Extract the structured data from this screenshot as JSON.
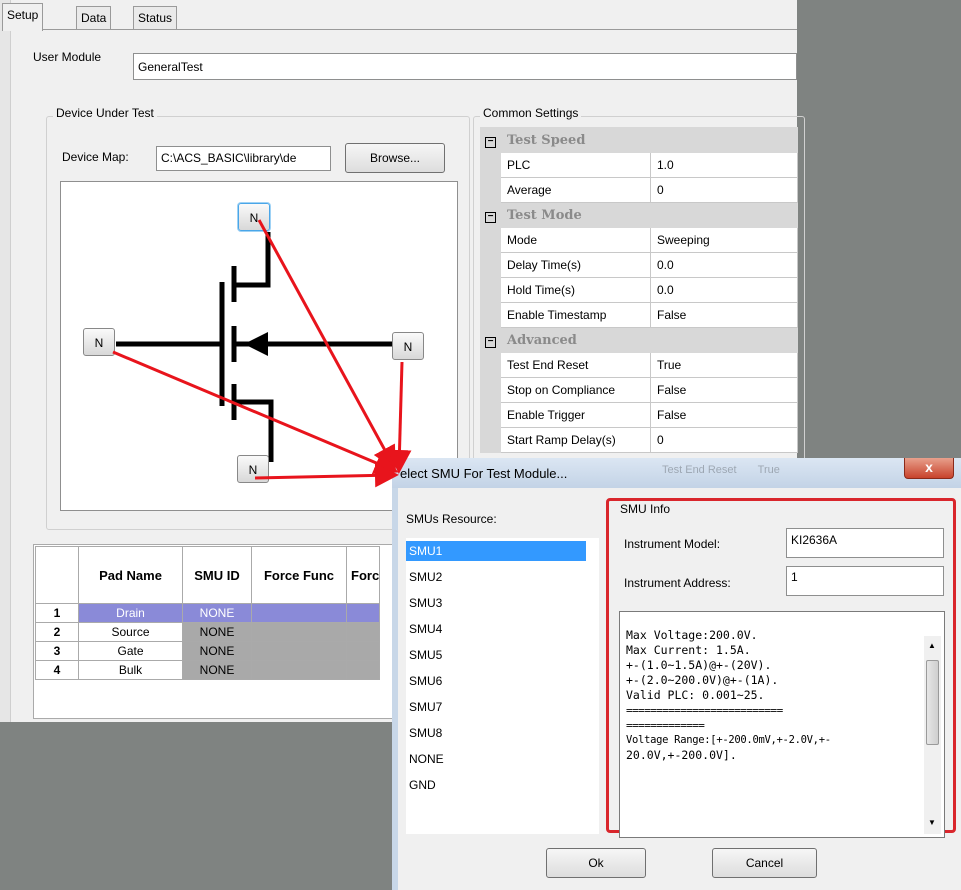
{
  "tabs": [
    {
      "label": "Setup"
    },
    {
      "label": "Data"
    },
    {
      "label": "Status"
    }
  ],
  "user_module": {
    "label": "User Module",
    "value": "GeneralTest"
  },
  "dut": {
    "legend": "Device Under Test",
    "device_map_label": "Device Map:",
    "device_map_value": "C:\\ACS_BASIC\\library\\de",
    "browse_label": "Browse...",
    "nodes": {
      "top": "N",
      "left": "N",
      "right": "N",
      "bottom": "N"
    }
  },
  "common_settings": {
    "legend": "Common Settings",
    "categories": [
      {
        "name": "Test Speed",
        "expander": "⊟",
        "rows": [
          {
            "name": "PLC",
            "value": "1.0"
          },
          {
            "name": "Average",
            "value": "0"
          }
        ]
      },
      {
        "name": "Test Mode",
        "expander": "⊟",
        "rows": [
          {
            "name": "Mode",
            "value": "Sweeping"
          },
          {
            "name": "Delay Time(s)",
            "value": "0.0"
          },
          {
            "name": "Hold Time(s)",
            "value": "0.0"
          },
          {
            "name": "Enable Timestamp",
            "value": "False"
          }
        ]
      },
      {
        "name": "Advanced",
        "expander": "⊟",
        "rows": [
          {
            "name": "Test End Reset",
            "value": "True"
          },
          {
            "name": "Stop on Compliance",
            "value": "False"
          },
          {
            "name": "Enable Trigger",
            "value": "False"
          },
          {
            "name": "Start Ramp Delay(s)",
            "value": "0"
          }
        ]
      }
    ]
  },
  "pad_table": {
    "headers": [
      "Pad Name",
      "SMU ID",
      "Force Func",
      "Forc"
    ],
    "rows": [
      {
        "num": "1",
        "pad": "Drain",
        "smu": "NONE"
      },
      {
        "num": "2",
        "pad": "Source",
        "smu": "NONE"
      },
      {
        "num": "3",
        "pad": "Gate",
        "smu": "NONE"
      },
      {
        "num": "4",
        "pad": "Bulk",
        "smu": "NONE"
      }
    ]
  },
  "dialog": {
    "title": "elect SMU For Test Module...",
    "close_glyph": "x",
    "resource_label": "SMUs Resource:",
    "smus": [
      "SMU1",
      "SMU2",
      "SMU3",
      "SMU4",
      "SMU5",
      "SMU6",
      "SMU7",
      "SMU8",
      "NONE",
      "GND"
    ],
    "selected": "SMU1",
    "info_legend": "SMU Info",
    "model_label": "Instrument Model:",
    "model_value": "KI2636A",
    "address_label": "Instrument Address:",
    "address_value": "1",
    "info_lines": [
      "Max Voltage:200.0V.",
      "Max Current: 1.5A.",
      "+-(1.0~1.5A)@+-(20V).",
      "+-(2.0~200.0V)@+-(1A).",
      "Valid PLC: 0.001~25.",
      "==========================",
      "=============",
      "Voltage Range:[+-200.0mV,+-2.0V,+-",
      "20.0V,+-200.0V]."
    ],
    "ok_label": "Ok",
    "cancel_label": "Cancel",
    "ghost_row": {
      "name": "Test End Reset",
      "value": "True"
    }
  },
  "colors": {
    "arrow": "#e8141c",
    "highlight_box": "#d9262c",
    "selection": "#3399ff",
    "pad_selection": "#8a8ad8"
  }
}
